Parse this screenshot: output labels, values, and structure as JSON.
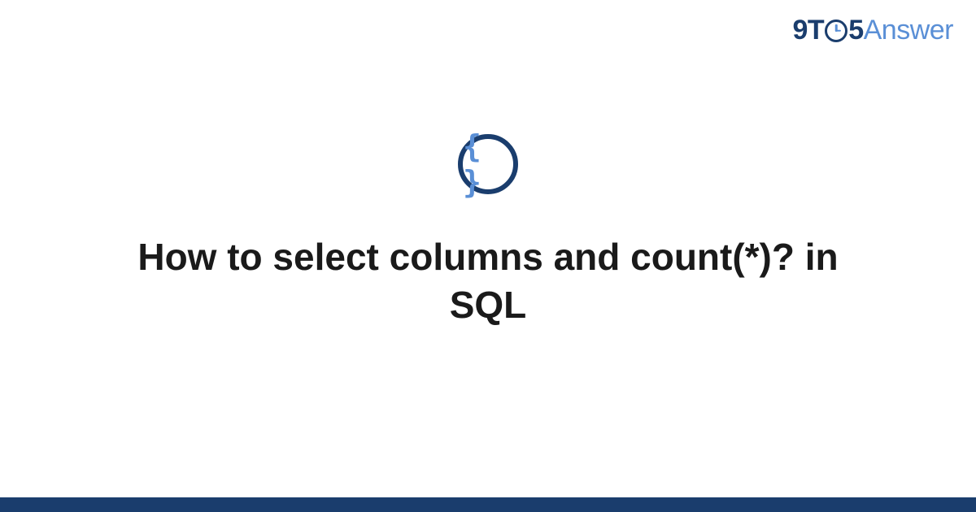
{
  "brand": {
    "part1": "9T",
    "part2": "5",
    "part3": "Answer"
  },
  "category_icon": {
    "symbol": "{ }",
    "name": "code-braces"
  },
  "question": {
    "title": "How to select columns and count(*)? in SQL"
  },
  "colors": {
    "dark_blue": "#1a3d6d",
    "light_blue": "#5a8fd6",
    "text": "#1a1a1a"
  }
}
